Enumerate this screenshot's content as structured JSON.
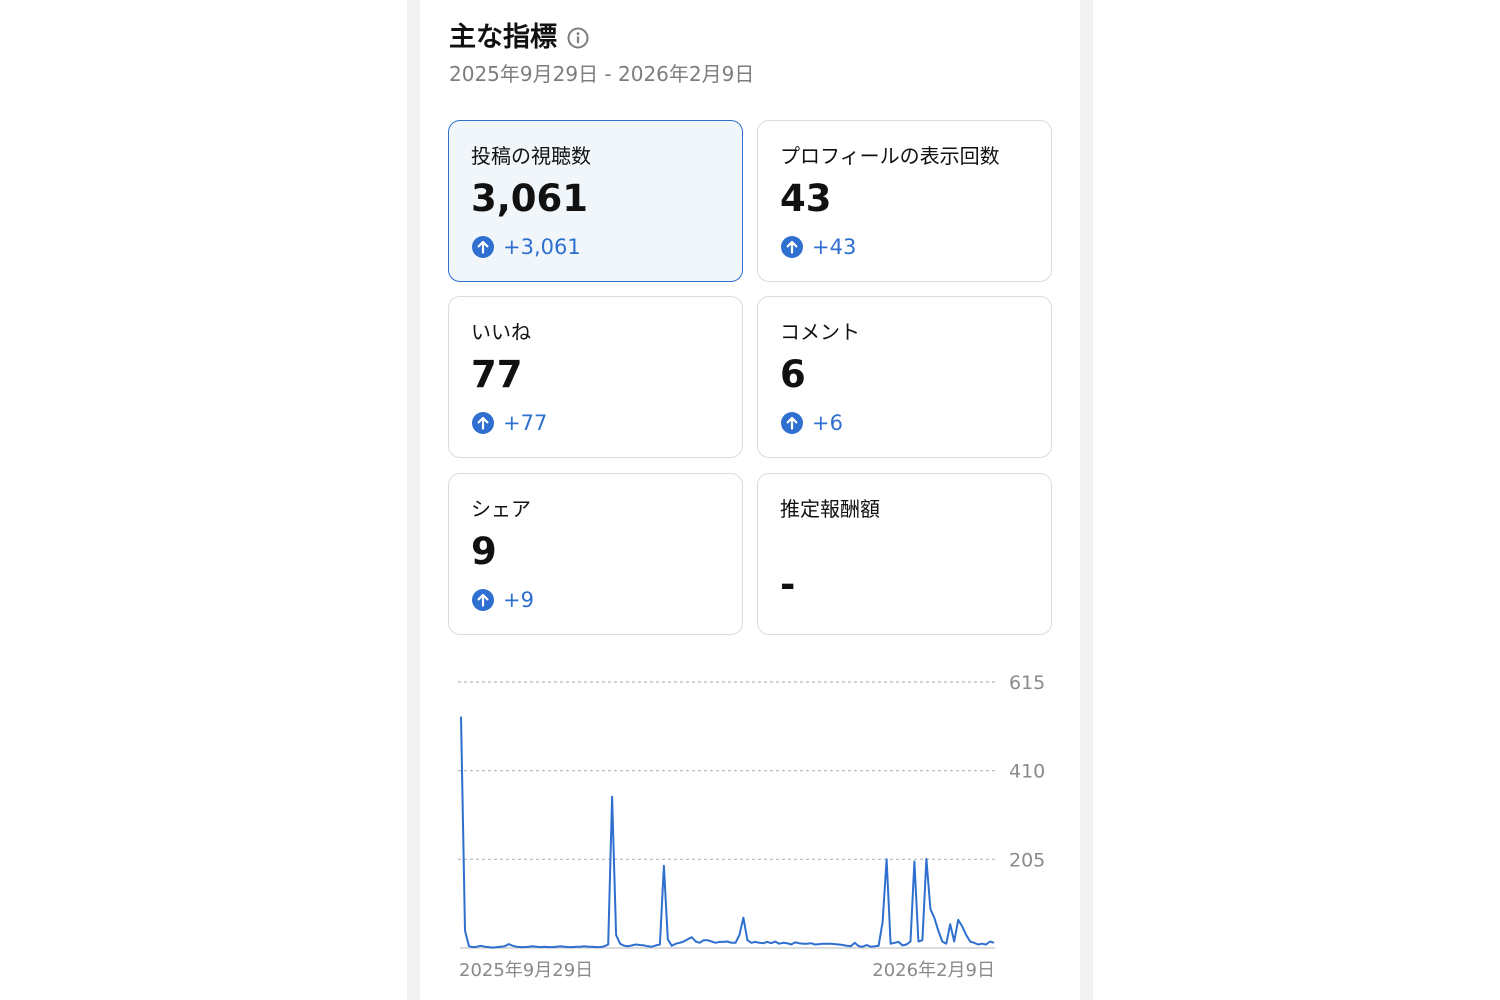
{
  "header": {
    "title": "主な指標",
    "date_range": "2025年9月29日 - 2026年2月9日"
  },
  "icons": {
    "info": "info-circle-icon",
    "up_arrow": "arrow-up-circle-icon"
  },
  "colors": {
    "accent": "#2f6fcf",
    "selected_bg": "#f1f6fa",
    "muted_text": "#7d7d7d"
  },
  "metrics": [
    {
      "label": "投稿の視聴数",
      "value": "3,061",
      "change": "+3,061",
      "selected": true
    },
    {
      "label": "プロフィールの表示回数",
      "value": "43",
      "change": "+43",
      "selected": false
    },
    {
      "label": "いいね",
      "value": "77",
      "change": "+77",
      "selected": false
    },
    {
      "label": "コメント",
      "value": "6",
      "change": "+6",
      "selected": false
    },
    {
      "label": "シェア",
      "value": "9",
      "change": "+9",
      "selected": false
    },
    {
      "label": "推定報酬額",
      "value": "-",
      "change": null,
      "selected": false
    }
  ],
  "chart_data": {
    "type": "line",
    "title": "",
    "xlabel": "",
    "ylabel": "",
    "y_ticks": [
      615,
      410,
      205
    ],
    "ylim": [
      0,
      615
    ],
    "x_tick_labels": [
      "2025年9月29日",
      "2026年2月9日"
    ],
    "grid": true,
    "series": [
      {
        "color": "#2f6fcf",
        "values": [
          535,
          40,
          4,
          2,
          3,
          5,
          3,
          2,
          1,
          2,
          3,
          4,
          9,
          5,
          3,
          2,
          2,
          3,
          4,
          3,
          2,
          3,
          2,
          2,
          3,
          4,
          3,
          2,
          2,
          3,
          3,
          4,
          3,
          3,
          2,
          2,
          4,
          8,
          350,
          30,
          10,
          5,
          4,
          6,
          8,
          7,
          6,
          4,
          3,
          6,
          8,
          190,
          20,
          5,
          10,
          12,
          15,
          20,
          25,
          15,
          12,
          18,
          18,
          15,
          12,
          14,
          14,
          15,
          12,
          12,
          30,
          70,
          18,
          12,
          14,
          12,
          11,
          14,
          11,
          15,
          10,
          12,
          11,
          8,
          13,
          11,
          10,
          10,
          11,
          8,
          9,
          10,
          10,
          10,
          9,
          8,
          7,
          5,
          4,
          12,
          4,
          3,
          7,
          3,
          4,
          5,
          60,
          205,
          10,
          12,
          14,
          6,
          8,
          15,
          200,
          15,
          18,
          206,
          90,
          70,
          40,
          15,
          10,
          55,
          15,
          65,
          50,
          30,
          15,
          12,
          8,
          10,
          8,
          15,
          12
        ]
      }
    ]
  }
}
